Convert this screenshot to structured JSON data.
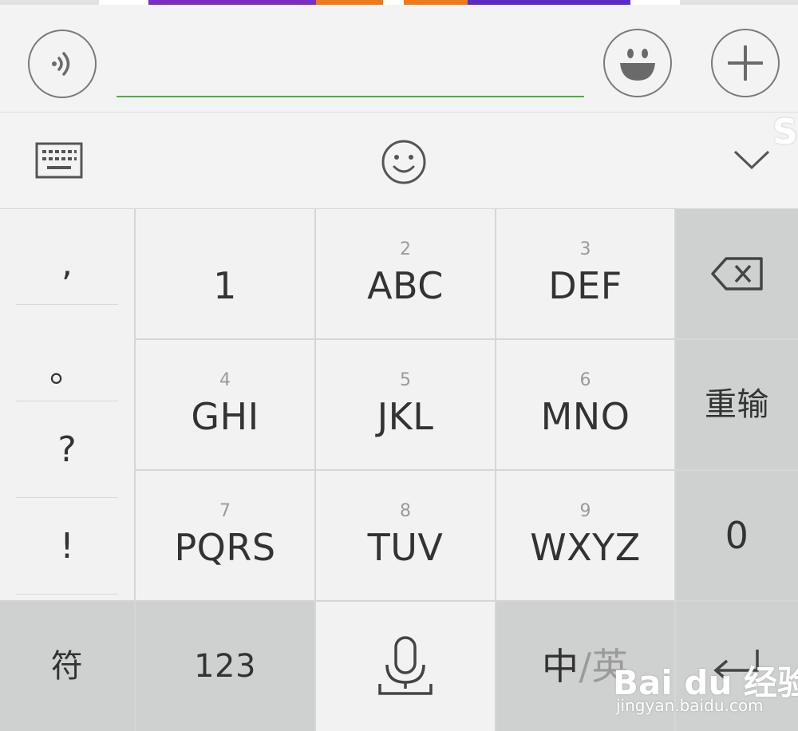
{
  "input_bar": {
    "text_value": "",
    "text_placeholder": ""
  },
  "keyboard": {
    "punctuation": [
      ",",
      "。",
      "?",
      "!"
    ],
    "rows": [
      [
        {
          "sub": "",
          "label": "1"
        },
        {
          "sub": "2",
          "label": "ABC"
        },
        {
          "sub": "3",
          "label": "DEF"
        }
      ],
      [
        {
          "sub": "4",
          "label": "GHI"
        },
        {
          "sub": "5",
          "label": "JKL"
        },
        {
          "sub": "6",
          "label": "MNO"
        }
      ],
      [
        {
          "sub": "7",
          "label": "PQRS"
        },
        {
          "sub": "8",
          "label": "TUV"
        },
        {
          "sub": "9",
          "label": "WXYZ"
        }
      ]
    ],
    "right_column": {
      "reinput_label": "重输",
      "zero_label": "0"
    },
    "bottom_row": {
      "symbols_label": "符",
      "numbers_label": "123",
      "lang_zh": "中",
      "lang_slash": "/",
      "lang_en": "英"
    }
  },
  "icons": {
    "voice": "voice-icon",
    "emoji": "emoji-icon",
    "plus": "plus-icon",
    "keyboard": "keyboard-icon",
    "smiley": "smiley-icon",
    "collapse": "chevron-down-icon",
    "backspace": "backspace-icon",
    "microphone": "microphone-icon",
    "enter": "enter-icon"
  },
  "watermark": {
    "brand": "Bai du 经验",
    "url": "jingyan.baidu.com"
  },
  "colors": {
    "input_underline": "#46b23a",
    "key_light": "#f2f2f2",
    "key_dark": "#cfd1d1",
    "chip_purple": "#7a2fc0",
    "chip_orange": "#f07a1a"
  }
}
